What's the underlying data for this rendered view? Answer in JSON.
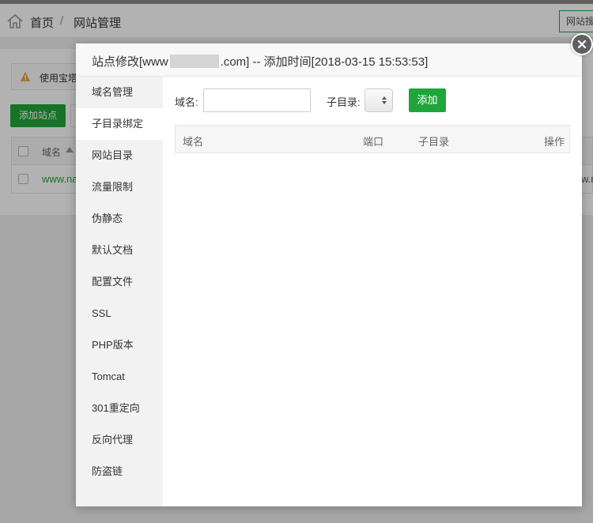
{
  "breadcrumb": {
    "home": "首页",
    "separator": "/",
    "current": "网站管理"
  },
  "bg": {
    "header_button": "网站搜",
    "notice_text": "使用宝塔",
    "add_site_button": "添加站点",
    "table_header_domain": "域名",
    "row_link": "www.na",
    "row_right": "w.n"
  },
  "modal": {
    "title_prefix": "站点修改[www",
    "title_suffix": ".com] -- 添加时间[2018-03-15 15:53:53]",
    "nav": [
      {
        "label": "域名管理"
      },
      {
        "label": "子目录绑定",
        "active": true
      },
      {
        "label": "网站目录"
      },
      {
        "label": "流量限制"
      },
      {
        "label": "伪静态"
      },
      {
        "label": "默认文档"
      },
      {
        "label": "配置文件"
      },
      {
        "label": "SSL"
      },
      {
        "label": "PHP版本"
      },
      {
        "label": "Tomcat"
      },
      {
        "label": "301重定向"
      },
      {
        "label": "反向代理"
      },
      {
        "label": "防盗链"
      }
    ],
    "form": {
      "domain_label": "域名:",
      "domain_value": "",
      "subdir_label": "子目录:",
      "add_button": "添加"
    },
    "table_headers": {
      "domain": "域名",
      "port": "端口",
      "subdir": "子目录",
      "action": "操作"
    }
  },
  "colors": {
    "accent": "#20a53a",
    "warning": "#e6a23c",
    "close_bg": "#606060"
  }
}
